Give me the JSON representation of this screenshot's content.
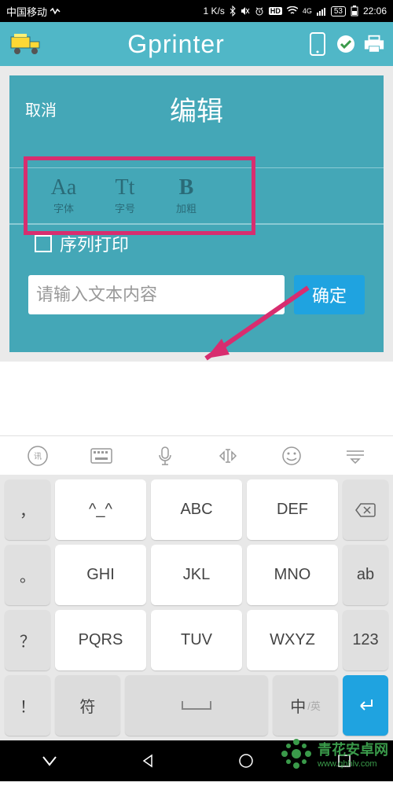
{
  "status": {
    "carrier": "中国移动",
    "speed": "1 K/s",
    "battery": "53",
    "time": "22:06"
  },
  "header": {
    "title": "Gprinter"
  },
  "dialog": {
    "cancel": "取消",
    "title": "编辑",
    "format": {
      "font_glyph": "Aa",
      "font_label": "字体",
      "size_glyph": "Tt",
      "size_label": "字号",
      "bold_glyph": "B",
      "bold_label": "加粗"
    },
    "sequence_label": "序列打印",
    "input_placeholder": "请输入文本内容",
    "confirm": "确定"
  },
  "keyboard": {
    "row1": {
      "k1": "，",
      "k2": "^_^",
      "k3": "ABC",
      "k4": "DEF",
      "k5": "⌫"
    },
    "row2": {
      "k1": "。",
      "k2": "GHI",
      "k3": "JKL",
      "k4": "MNO",
      "k5": "ab"
    },
    "row3": {
      "k1": "？",
      "k2": "PQRS",
      "k3": "TUV",
      "k4": "WXYZ",
      "k5": "123"
    },
    "row4": {
      "k1": "！",
      "k2": "符",
      "k4_main": "中",
      "k4_sub": "/英"
    }
  },
  "watermark": {
    "name": "青花安卓网",
    "url": "www.qhhlv.com"
  }
}
